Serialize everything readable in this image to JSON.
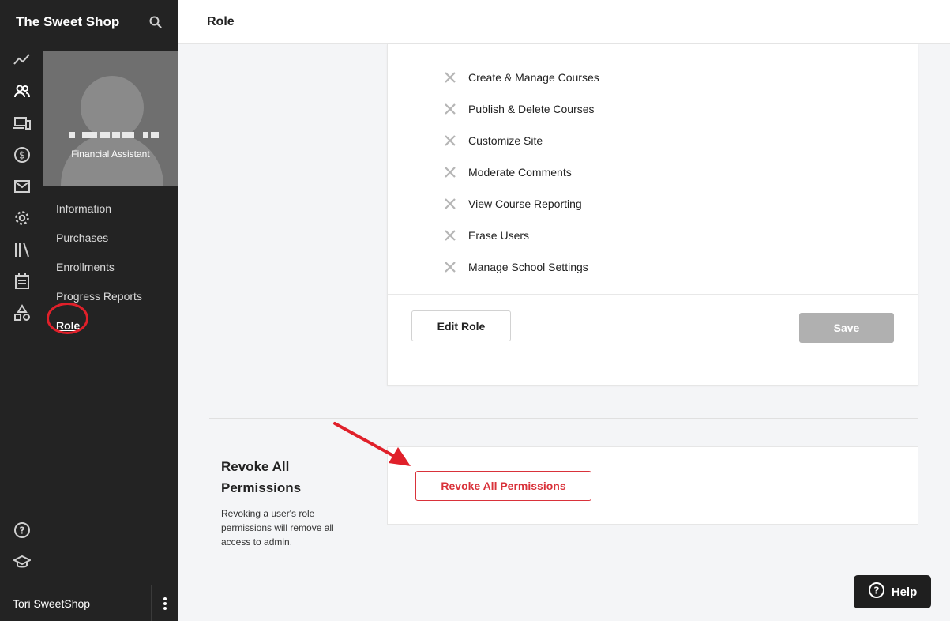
{
  "app": {
    "brand": "The Sweet Shop"
  },
  "header": {
    "title": "Role"
  },
  "profile": {
    "role_label": "Financial Assistant"
  },
  "nav": {
    "items": [
      {
        "label": "Information"
      },
      {
        "label": "Purchases"
      },
      {
        "label": "Enrollments"
      },
      {
        "label": "Progress Reports"
      },
      {
        "label": "Role"
      }
    ]
  },
  "permissions": [
    {
      "label": "Create & Manage Courses"
    },
    {
      "label": "Publish & Delete Courses"
    },
    {
      "label": "Customize Site"
    },
    {
      "label": "Moderate Comments"
    },
    {
      "label": "View Course Reporting"
    },
    {
      "label": "Erase Users"
    },
    {
      "label": "Manage School Settings"
    }
  ],
  "buttons": {
    "edit_role": "Edit Role",
    "save": "Save",
    "revoke": "Revoke All Permissions",
    "help": "Help"
  },
  "revoke_section": {
    "title": "Revoke All Permissions",
    "description": "Revoking a user's role permissions will remove all access to admin."
  },
  "user": {
    "name": "Tori SweetShop"
  },
  "colors": {
    "sidebar": "#232323",
    "danger": "#d9323a",
    "disabled": "#b0b0b0"
  },
  "icons": [
    "search-icon",
    "analytics-icon",
    "users-icon",
    "devices-icon",
    "dollar-icon",
    "mail-icon",
    "gear-icon",
    "library-icon",
    "calendar-icon",
    "shapes-icon",
    "question-icon",
    "graduation-cap-icon",
    "x-icon",
    "kebab-icon",
    "help-icon"
  ]
}
